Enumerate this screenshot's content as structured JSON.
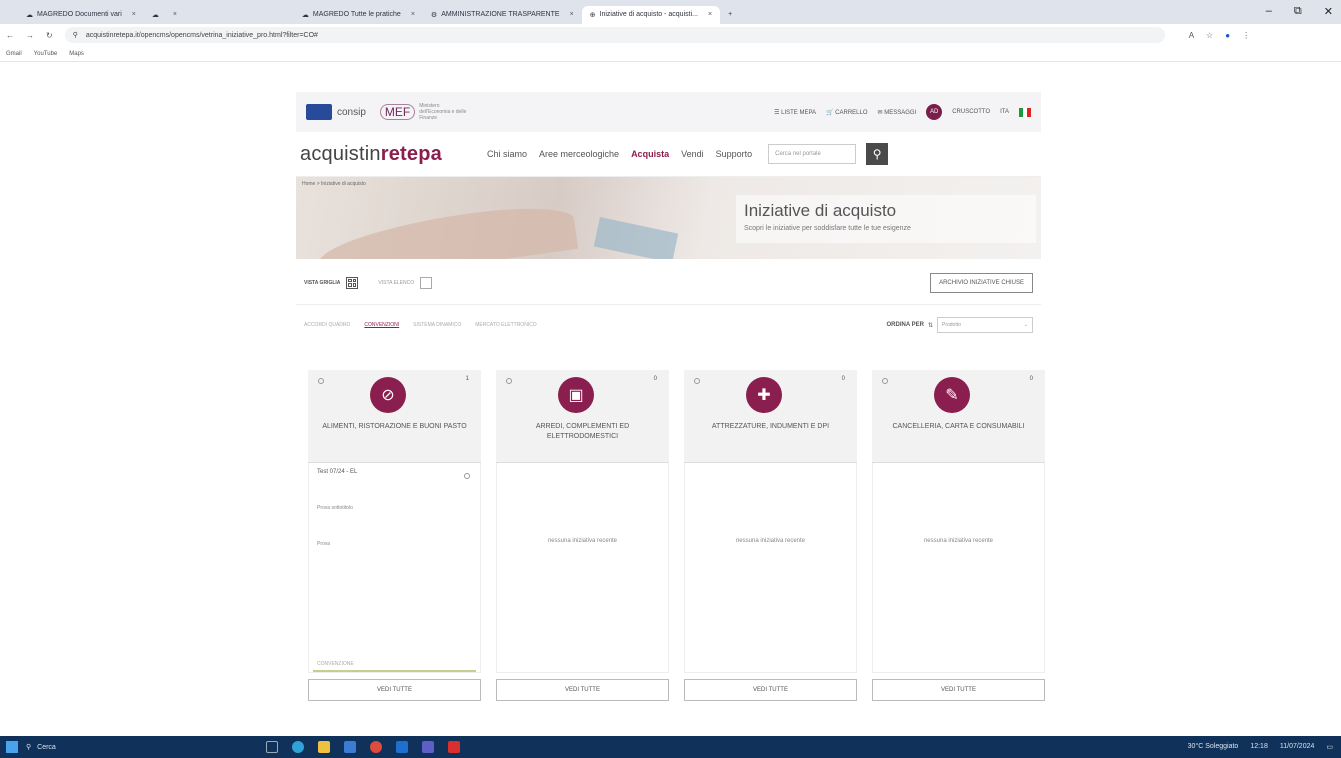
{
  "browser": {
    "tabs": [
      {
        "label": "MAGREDO Documenti vari"
      },
      {
        "label": ""
      },
      {
        "label": "MAGREDO Tutte le pratiche"
      },
      {
        "label": "AMMINISTRAZIONE TRASPARENTE"
      },
      {
        "label": "Iniziative di acquisto - acquisti..."
      }
    ],
    "address": "acquistinretepa.it/opencms/opencms/vetrina_iniziative_pro.html?filter=CO#",
    "bookmarks": [
      "Gmail",
      "YouTube",
      "Maps"
    ]
  },
  "site": {
    "util": {
      "brand": "consip",
      "mef": "MEF",
      "mef_sub": "Ministero dell'Economia e delle Finanze",
      "links": [
        "LISTE MEPA",
        "CARRELLO",
        "MESSAGGI"
      ],
      "user_initials": "AD",
      "user_label": "CRUSCOTTO",
      "lang": "ITA"
    },
    "nav": {
      "logo_a": "acquistin",
      "logo_b": "rete",
      "logo_c": "pa",
      "links": [
        "Chi siamo",
        "Aree merceologiche",
        "Acquista",
        "Vendi",
        "Supporto"
      ],
      "search_placeholder": "Cerca nel portale"
    },
    "hero": {
      "breadcrumb": "Home > Iniziative di acquisto",
      "title": "Iniziative di acquisto",
      "subtitle": "Scopri le iniziative per soddisfare tutte le tue esigenze"
    },
    "views": {
      "grid_label": "VISTA GRIGLIA",
      "list_label": "VISTA ELENCO",
      "archive": "ARCHIVIO INIZIATIVE CHIUSE"
    },
    "filters": {
      "items": [
        "ACCORDI QUADRO",
        "CONVENZIONI",
        "SISTEMA DINAMICO",
        "MERCATO ELETTRONICO"
      ],
      "sort_label": "ORDINA PER",
      "sort_value": "Prodotto"
    },
    "cards": [
      {
        "name": "ALIMENTI, RISTORAZIONE E BUONI PASTO",
        "count": "1",
        "icon": "food-icon",
        "item_title": "Test 07/24 - EL",
        "item_line1": "Prova sottotitolo",
        "item_line2": "Prova",
        "item_type": "CONVENZIONE",
        "view_all": "VEDI TUTTE"
      },
      {
        "name": "ARREDI, COMPLEMENTI ED ELETTRODOMESTICI",
        "count": "0",
        "icon": "furniture-icon",
        "empty": "nessuna iniziativa recente",
        "view_all": "VEDI TUTTE"
      },
      {
        "name": "ATTREZZATURE, INDUMENTI E DPI",
        "count": "0",
        "icon": "tools-icon",
        "empty": "nessuna iniziativa recente",
        "view_all": "VEDI TUTTE"
      },
      {
        "name": "CANCELLERIA, CARTA E CONSUMABILI",
        "count": "0",
        "icon": "stationery-icon",
        "empty": "nessuna iniziativa recente",
        "view_all": "VEDI TUTTE"
      }
    ]
  },
  "taskbar": {
    "search": "Cerca",
    "weather": "30°C Soleggiato",
    "time": "12:18",
    "date": "11/07/2024"
  }
}
